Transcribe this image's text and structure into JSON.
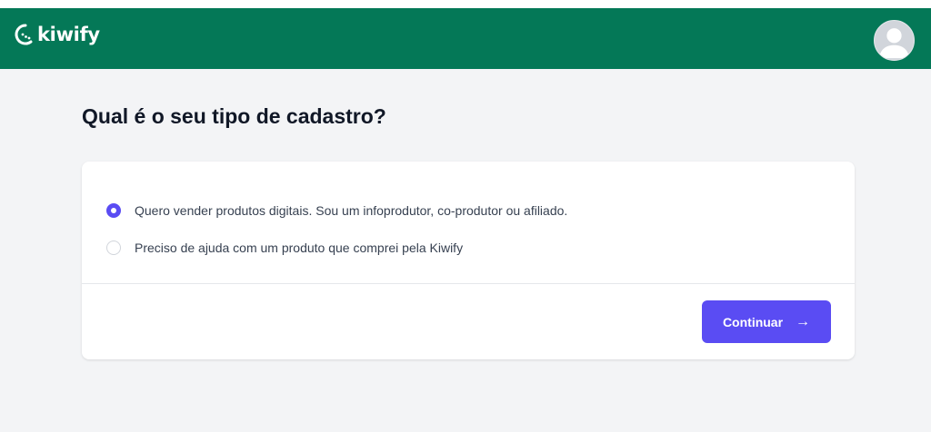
{
  "header": {
    "brand_name": "kiwify",
    "background_color": "#047857",
    "avatar_icon": "user-avatar-icon"
  },
  "main": {
    "title": "Qual é o seu tipo de cadastro?",
    "options": [
      {
        "label": "Quero vender produtos digitais. Sou um infoprodutor, co-produtor ou afiliado.",
        "selected": true
      },
      {
        "label": "Preciso de ajuda com um produto que comprei pela Kiwify",
        "selected": false
      }
    ],
    "continue_label": "Continuar",
    "continue_icon": "arrow-right-icon",
    "accent_color": "#5a4cf3"
  }
}
